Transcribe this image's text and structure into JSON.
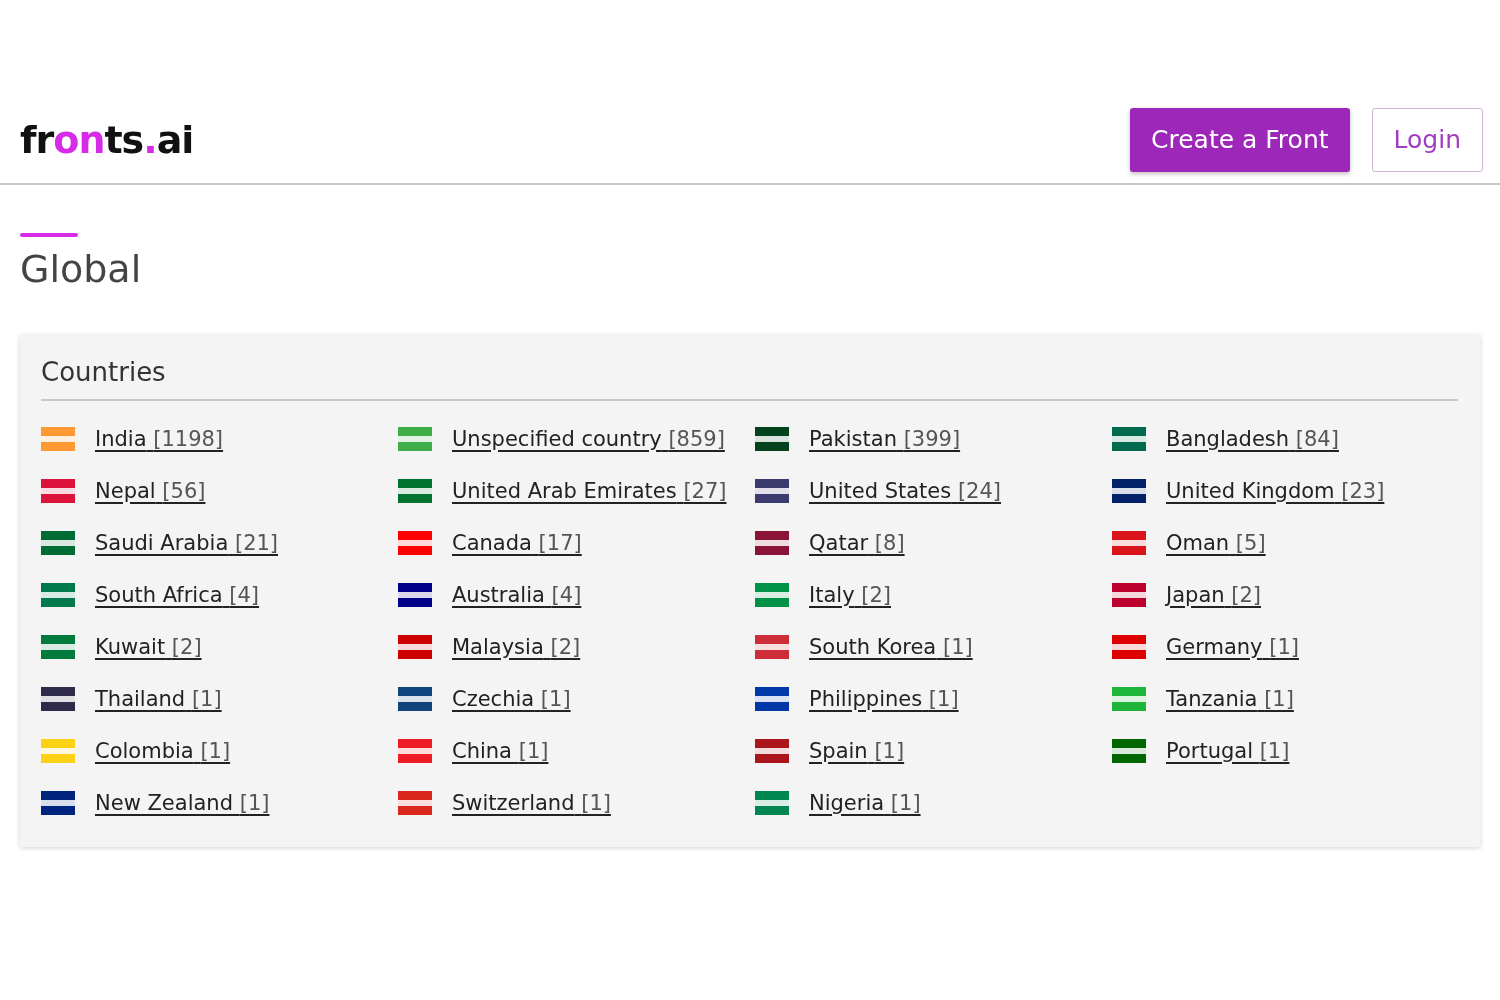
{
  "header": {
    "logo": [
      {
        "text": "fr",
        "highlight": false
      },
      {
        "text": "on",
        "highlight": true
      },
      {
        "text": "ts",
        "highlight": false
      },
      {
        "text": ".",
        "highlight": true
      },
      {
        "text": "ai",
        "highlight": false
      }
    ],
    "buttons": [
      {
        "label": "Create a Front",
        "kind": "primary"
      },
      {
        "label": "Login",
        "kind": "outline"
      }
    ]
  },
  "section": {
    "title": "Global"
  },
  "card": {
    "title": "Countries",
    "countries": [
      {
        "name": "India",
        "count": "[1198]",
        "color": "#ff9933"
      },
      {
        "name": "Unspecified country",
        "count": "[859]",
        "color": "#3fae49"
      },
      {
        "name": "Pakistan",
        "count": "[399]",
        "color": "#01411c"
      },
      {
        "name": "Bangladesh",
        "count": "[84]",
        "color": "#006a4e"
      },
      {
        "name": "Nepal",
        "count": "[56]",
        "color": "#dc143c"
      },
      {
        "name": "United Arab Emirates",
        "count": "[27]",
        "color": "#00732f"
      },
      {
        "name": "United States",
        "count": "[24]",
        "color": "#3c3b6e"
      },
      {
        "name": "United Kingdom",
        "count": "[23]",
        "color": "#012169"
      },
      {
        "name": "Saudi Arabia",
        "count": "[21]",
        "color": "#006c35"
      },
      {
        "name": "Canada",
        "count": "[17]",
        "color": "#ff0000"
      },
      {
        "name": "Qatar",
        "count": "[8]",
        "color": "#8a1538"
      },
      {
        "name": "Oman",
        "count": "[5]",
        "color": "#db161b"
      },
      {
        "name": "South Africa",
        "count": "[4]",
        "color": "#007a4d"
      },
      {
        "name": "Australia",
        "count": "[4]",
        "color": "#00008b"
      },
      {
        "name": "Italy",
        "count": "[2]",
        "color": "#009246"
      },
      {
        "name": "Japan",
        "count": "[2]",
        "color": "#bc002d"
      },
      {
        "name": "Kuwait",
        "count": "[2]",
        "color": "#007a3d"
      },
      {
        "name": "Malaysia",
        "count": "[2]",
        "color": "#cc0001"
      },
      {
        "name": "South Korea",
        "count": "[1]",
        "color": "#cd2e3a"
      },
      {
        "name": "Germany",
        "count": "[1]",
        "color": "#dd0000"
      },
      {
        "name": "Thailand",
        "count": "[1]",
        "color": "#2d2a4a"
      },
      {
        "name": "Czechia",
        "count": "[1]",
        "color": "#11457e"
      },
      {
        "name": "Philippines",
        "count": "[1]",
        "color": "#0038a8"
      },
      {
        "name": "Tanzania",
        "count": "[1]",
        "color": "#1eb53a"
      },
      {
        "name": "Colombia",
        "count": "[1]",
        "color": "#fcd116"
      },
      {
        "name": "China",
        "count": "[1]",
        "color": "#ee1c25"
      },
      {
        "name": "Spain",
        "count": "[1]",
        "color": "#aa151b"
      },
      {
        "name": "Portugal",
        "count": "[1]",
        "color": "#006600"
      },
      {
        "name": "New Zealand",
        "count": "[1]",
        "color": "#00247d"
      },
      {
        "name": "Switzerland",
        "count": "[1]",
        "color": "#da291c"
      },
      {
        "name": "Nigeria",
        "count": "[1]",
        "color": "#008751"
      }
    ]
  }
}
